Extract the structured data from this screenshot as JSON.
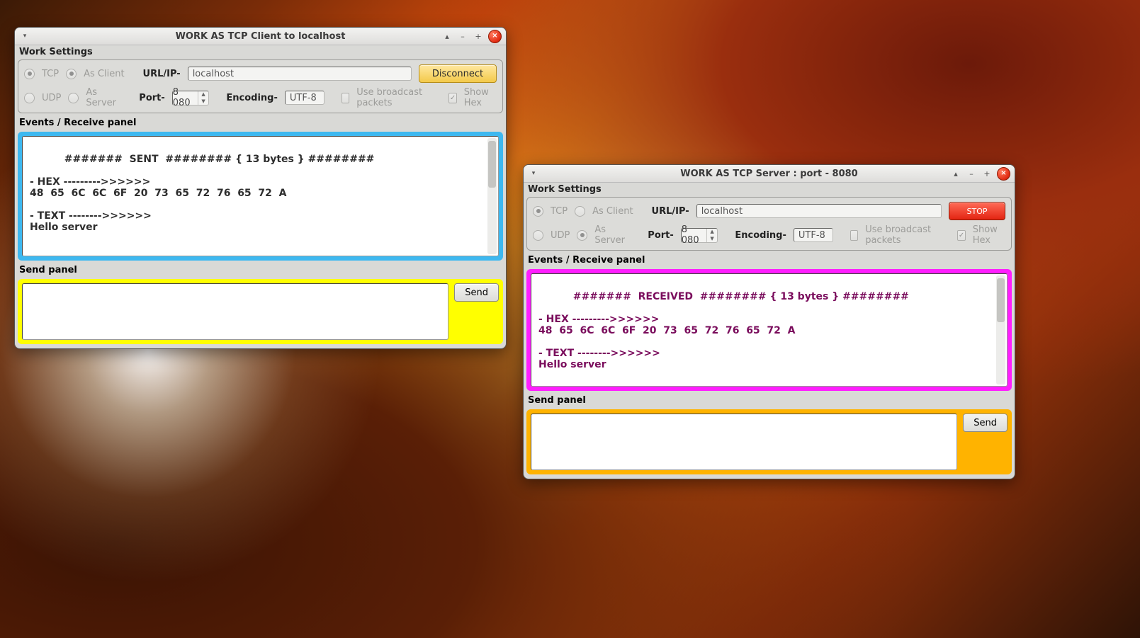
{
  "client": {
    "title": "WORK AS  TCP  Client to  localhost",
    "settings_label": "Work Settings",
    "protocol": {
      "tcp_label": "TCP",
      "udp_label": "UDP",
      "tcp_selected": true
    },
    "role": {
      "client_label": "As Client",
      "server_label": "As Server",
      "client_selected": true
    },
    "url_label": "URL/IP-",
    "url_value": "localhost",
    "connect_button": "Disconnect",
    "port_label": "Port-",
    "port_value": "8 080",
    "encoding_label": "Encoding-",
    "encoding_value": "UTF-8",
    "broadcast_label": "Use broadcast packets",
    "showhex_label": "Show Hex",
    "showhex_checked": true,
    "recv_label": "Events / Receive panel",
    "recv_text": "#######  SENT  ######## { 13 bytes } ########\n\n- HEX --------->>>>>>\n48  65  6C  6C  6F  20  73  65  72  76  65  72  A\n\n- TEXT -------->>>>>>\nHello server",
    "send_label": "Send panel",
    "send_value": "",
    "send_button": "Send"
  },
  "server": {
    "title": "WORK AS  TCP  Server  : port - 8080",
    "settings_label": "Work Settings",
    "protocol": {
      "tcp_label": "TCP",
      "udp_label": "UDP",
      "tcp_selected": true
    },
    "role": {
      "client_label": "As Client",
      "server_label": "As Server",
      "server_selected": true
    },
    "url_label": "URL/IP-",
    "url_value": "localhost",
    "connect_button": "STOP",
    "port_label": "Port-",
    "port_value": "8 080",
    "encoding_label": "Encoding-",
    "encoding_value": "UTF-8",
    "broadcast_label": "Use broadcast packets",
    "showhex_label": "Show Hex",
    "showhex_checked": true,
    "recv_label": "Events / Receive panel",
    "recv_text": "#######  RECEIVED  ######## { 13 bytes } ########\n\n- HEX --------->>>>>>\n48  65  6C  6C  6F  20  73  65  72  76  65  72  A\n\n- TEXT -------->>>>>>\nHello server",
    "send_label": "Send panel",
    "send_value": "",
    "send_button": "Send"
  },
  "colors": {
    "client_recv_panel": "#3db8f0",
    "client_send_panel": "#ffff00",
    "server_recv_panel": "#ff1dff",
    "server_send_panel": "#ffb300",
    "disconnect_button": "#f3c94a",
    "stop_button": "#e32512"
  }
}
